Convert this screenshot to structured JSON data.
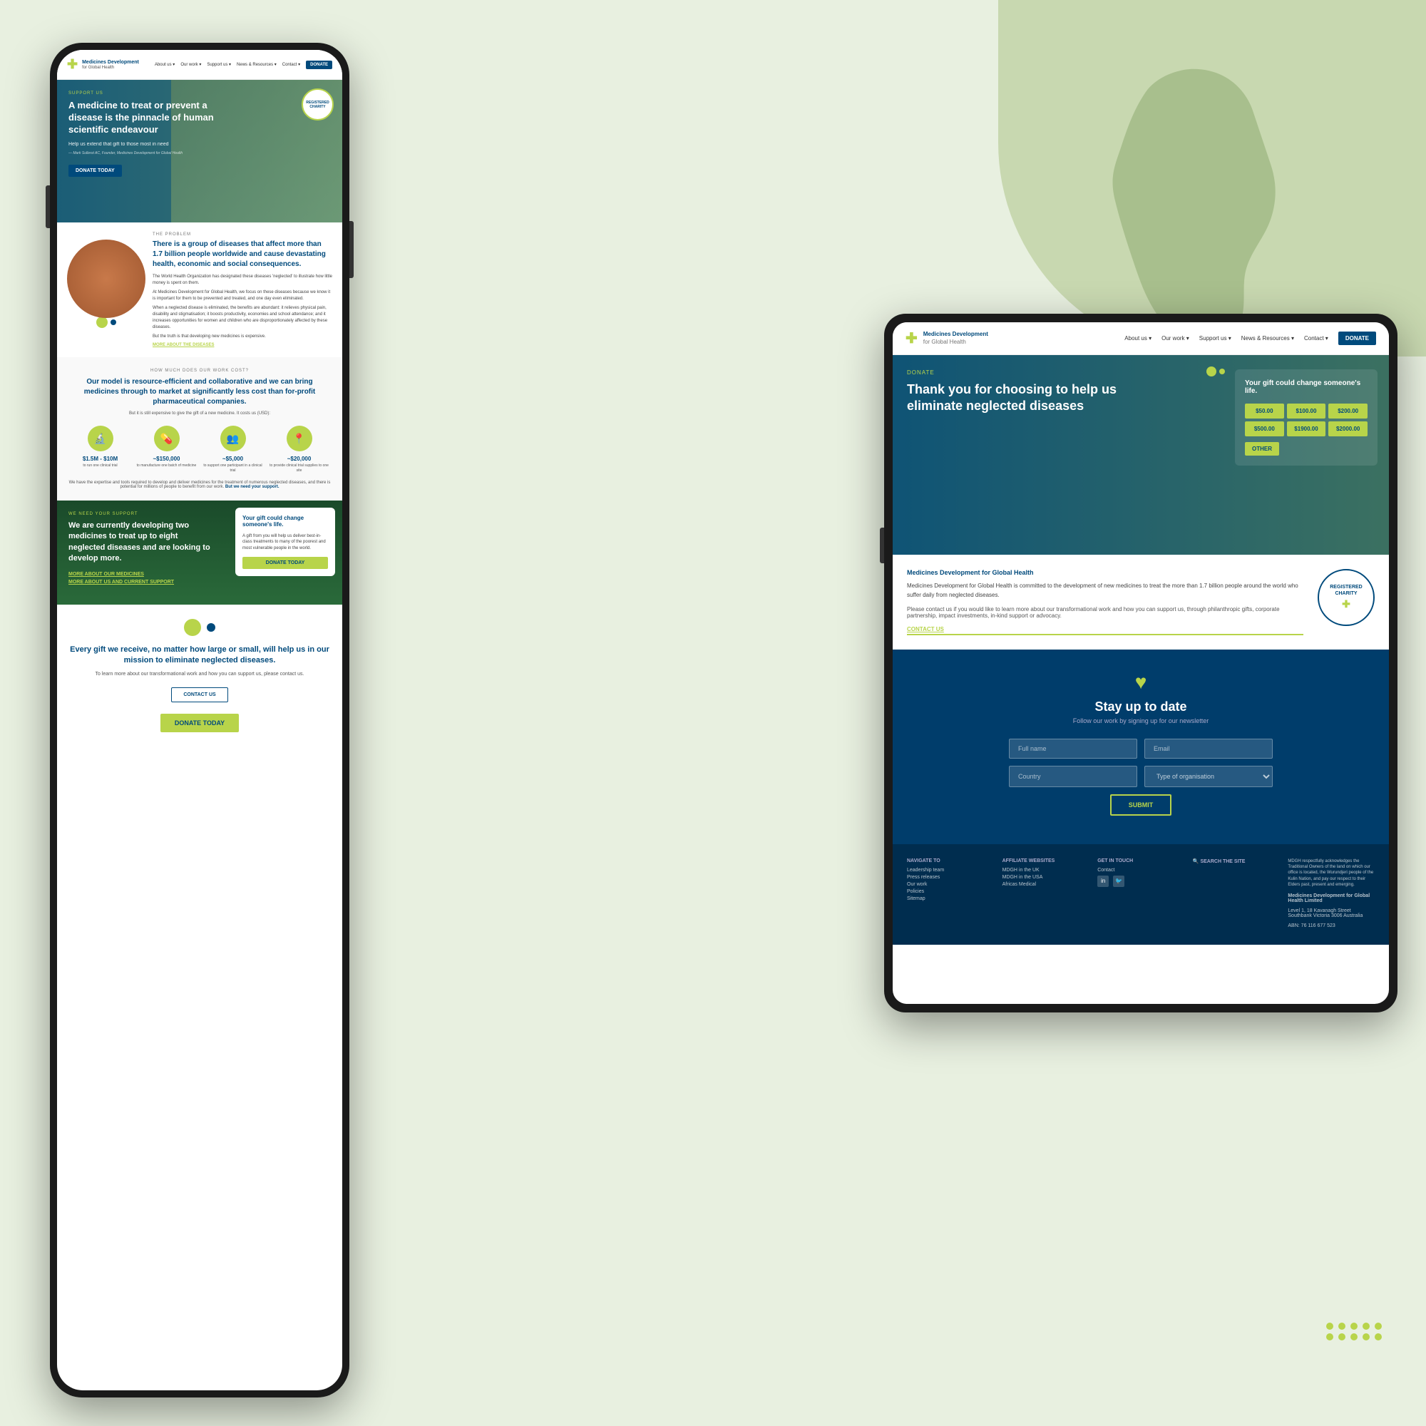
{
  "background": {
    "color": "#e8f0e0",
    "shape_color": "#c8d8b0"
  },
  "phone": {
    "nav": {
      "logo_cross": "✚",
      "logo_text": "Medicines Development",
      "logo_sub": "for Global Health",
      "links": [
        "About us",
        "Our work",
        "Support us",
        "News & Resources",
        "Contact"
      ],
      "donate_btn": "DONATE"
    },
    "hero": {
      "support_label": "SUPPORT US",
      "title": "A medicine to treat or prevent a disease is the pinnacle of human scientific endeavour",
      "subtitle": "Help us extend that gift to those most in need",
      "quote": "— Mark Sullerot AC, Founder, Medicines Development for Global Health",
      "donate_btn": "DONATE TODAY",
      "badge_text": "REGISTERED CHARITY"
    },
    "problem": {
      "label": "THE PROBLEM",
      "title": "There is a group of diseases that affect more than 1.7 billion people worldwide and cause devastating health, economic and social consequences.",
      "who_text": "The World Health Organization has designated these diseases 'neglected' to illustrate how little money is spent on them.",
      "body1": "At Medicines Development for Global Health, we focus on these diseases because we know it is important for them to be prevented and treated, and one day even eliminated.",
      "body2": "When a neglected disease is eliminated, the benefits are abundant: it relieves physical pain, disability and stigmatisation; it boosts productivity, economies and school attendance; and it increases opportunities for women and children who are disproportionately affected by these diseases.",
      "body3": "But the truth is that developing new medicines is expensive.",
      "link": "MORE ABOUT THE DISEASES"
    },
    "cost": {
      "label": "HOW MUCH DOES OUR WORK COST?",
      "title": "Our model is resource-efficient and collaborative and we can bring medicines through to market at significantly less cost than for-profit pharmaceutical companies.",
      "sub": "But it is still expensive to give the gift of a new medicine. It costs us (USD):",
      "items": [
        {
          "icon": "🔬",
          "amount": "$1.5M - $10M",
          "desc": "to run one clinical trial"
        },
        {
          "icon": "💊",
          "amount": "~$150,000",
          "desc": "to manufacture one batch of medicine"
        },
        {
          "icon": "👥",
          "amount": "~$5,000",
          "desc": "to support one participant in a clinical trial"
        },
        {
          "icon": "📍",
          "amount": "~$20,000",
          "desc": "to provide clinical trial supplies to one site"
        }
      ],
      "footer": "We have the expertise and tools required to develop and deliver medicines for the treatment of numerous neglected diseases, and there is potential for millions of people to benefit from our work. But we need your support."
    },
    "support": {
      "label": "WE NEED YOUR SUPPORT",
      "title": "We are currently developing two medicines to treat up to eight neglected diseases and are looking to develop more.",
      "link1": "MORE ABOUT OUR MEDICINES",
      "link2": "MORE ABOUT US AND CURRENT SUPPORT",
      "gift_title": "Your gift could change someone's life.",
      "gift_text": "A gift from you will help us deliver best-in-class treatments to many of the poorest and most vulnerable people in the world.",
      "gift_btn": "DONATE TODAY"
    },
    "every_gift": {
      "title": "Every gift we receive, no matter how large or small, will help us in our mission to eliminate neglected diseases.",
      "sub": "To learn more about our transformational work and how you can support us, please contact us.",
      "contact_btn": "CONTACT US",
      "donate_btn": "DONATE TODAY"
    }
  },
  "tablet": {
    "nav": {
      "logo_cross": "✚",
      "logo_text": "Medicines Development",
      "logo_sub": "for Global Health",
      "links": [
        "About us",
        "Our work",
        "Support us",
        "News & Resources",
        "Contact"
      ],
      "donate_btn": "DONATE"
    },
    "hero": {
      "sup_label": "DONATE",
      "title": "Thank you for choosing to help us eliminate neglected diseases",
      "gift_panel": {
        "title": "Your gift could change someone's life.",
        "amounts": [
          "$50.00",
          "$100.00",
          "$200.00",
          "$500.00",
          "$1900.00",
          "$2000.00"
        ],
        "other_btn": "OTHER"
      }
    },
    "about": {
      "org_name": "Medicines Development for Global Health",
      "desc1": "Medicines Development for Global Health is committed to the development of new medicines to treat the more than 1.7 billion people around the world who suffer daily from neglected diseases.",
      "desc2": "Please contact us if you would like to learn more about our transformational work and how you can support us, through philanthropic gifts, corporate partnership, impact investments, in-kind support or advocacy.",
      "contact_link": "CONTACT US",
      "badge_text": "REGISTERED CHARITY"
    },
    "newsletter": {
      "title": "Stay up to date",
      "sub": "Follow our work by signing up for our newsletter",
      "fields": {
        "full_name": "Full name",
        "email": "Email",
        "country": "Country",
        "org_type": "Type of organisation"
      },
      "submit_btn": "SUBMIT"
    },
    "footer": {
      "cols": [
        {
          "title": "Navigate to",
          "links": [
            "Leadership team",
            "Press releases",
            "Our work",
            "Policies",
            "Sitemap"
          ]
        },
        {
          "title": "Affiliate websites",
          "links": [
            "MDGH in the UK",
            "MDGH in the USA",
            "Africas Medical"
          ]
        },
        {
          "title": "Get in touch",
          "links": [
            "Contact"
          ],
          "social": [
            "in",
            "🐦"
          ]
        },
        {
          "title": "Search the site",
          "links": []
        },
        {
          "title": "",
          "links": [
            "MDGH respectfully acknowledges the Traditional Owners of the land on which our office is located, the Wurundjeri people of the Kulin Nation, and pay our respect to their Elders past, present and emerging.",
            "Medicines Development for Global Health Limited",
            "Level 1, 18 Kavanagh Street Southbank Victoria 3006 Australia",
            "ABN: 76 116 677 523"
          ]
        }
      ]
    }
  }
}
